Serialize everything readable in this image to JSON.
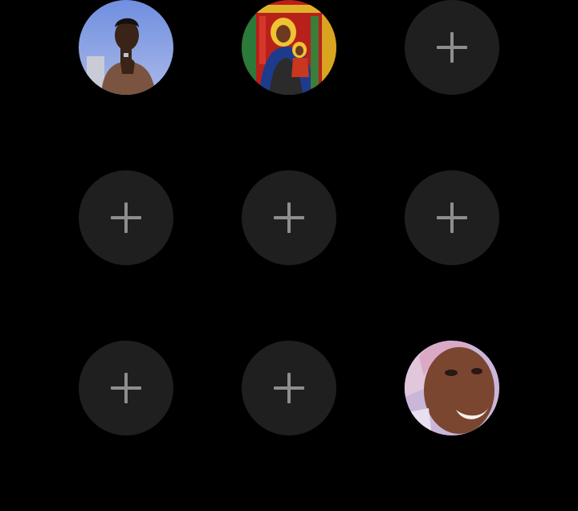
{
  "slots": [
    {
      "type": "avatar",
      "icon": "user-photo-1"
    },
    {
      "type": "avatar",
      "icon": "user-photo-2"
    },
    {
      "type": "empty",
      "icon": "plus-icon"
    },
    {
      "type": "empty",
      "icon": "plus-icon"
    },
    {
      "type": "empty",
      "icon": "plus-icon"
    },
    {
      "type": "empty",
      "icon": "plus-icon"
    },
    {
      "type": "empty",
      "icon": "plus-icon"
    },
    {
      "type": "empty",
      "icon": "plus-icon"
    },
    {
      "type": "avatar",
      "icon": "user-photo-3"
    }
  ],
  "colors": {
    "background": "#000000",
    "empty_slot": "#1f1f1f",
    "plus": "#8e8e8e"
  }
}
